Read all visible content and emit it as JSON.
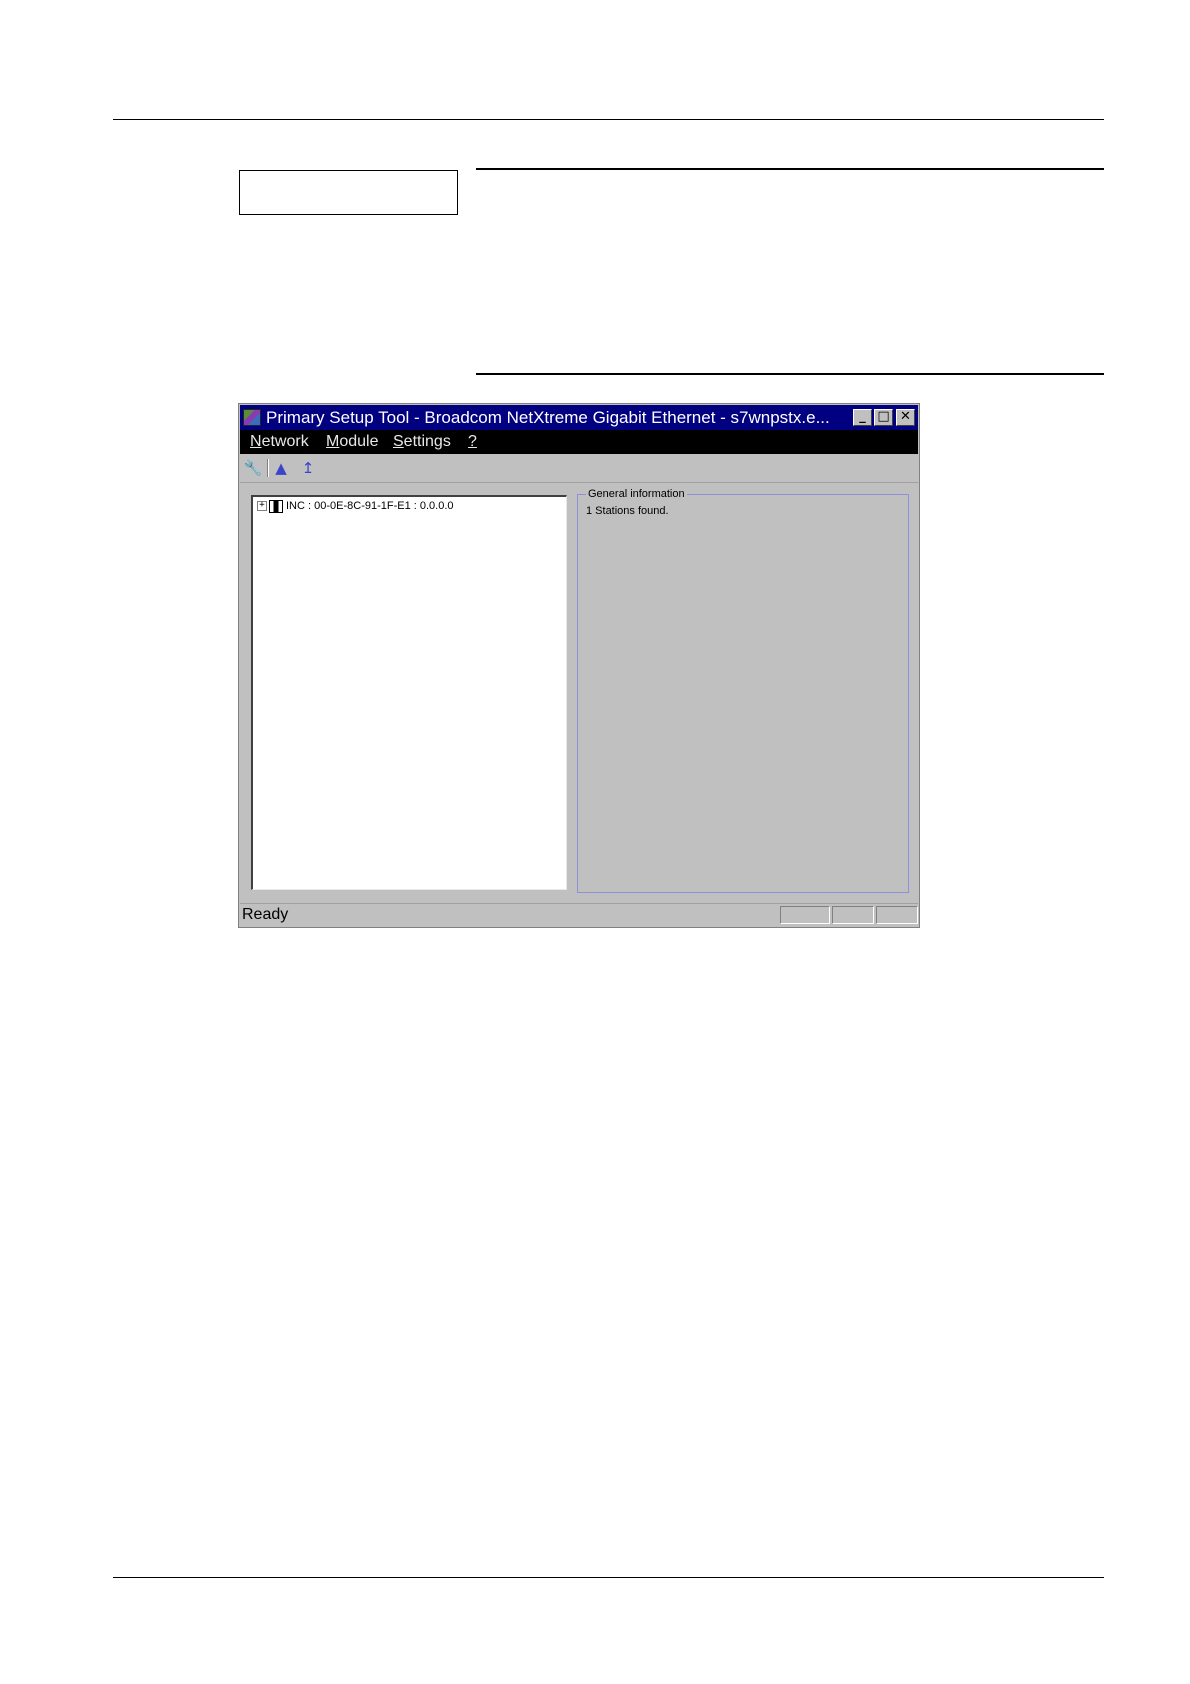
{
  "window": {
    "title": "Primary Setup Tool - Broadcom NetXtreme Gigabit Ethernet - s7wnpstx.e...",
    "app_icon": "app-icon",
    "caption_buttons": {
      "minimize": "_",
      "maximize": "□",
      "close": "✕"
    }
  },
  "menubar": {
    "items": [
      {
        "label": "Network",
        "mnemonic": "N",
        "rest": "etwork"
      },
      {
        "label": "Module",
        "mnemonic": "M",
        "rest": "odule"
      },
      {
        "label": "Settings",
        "mnemonic": "S",
        "rest": "ettings"
      },
      {
        "label": "?",
        "mnemonic": "?",
        "rest": ""
      }
    ]
  },
  "toolbar": {
    "icons": [
      "wrench-icon",
      "download-icon",
      "upload-icon"
    ],
    "glyphs": [
      "🔧",
      "▲",
      "↥"
    ]
  },
  "tree": {
    "expand": "+",
    "node_label": "INC : 00-0E-8C-91-1F-E1 : 0.0.0.0"
  },
  "info": {
    "legend": "General information",
    "message": "1 Stations found."
  },
  "status": {
    "text": "Ready"
  }
}
